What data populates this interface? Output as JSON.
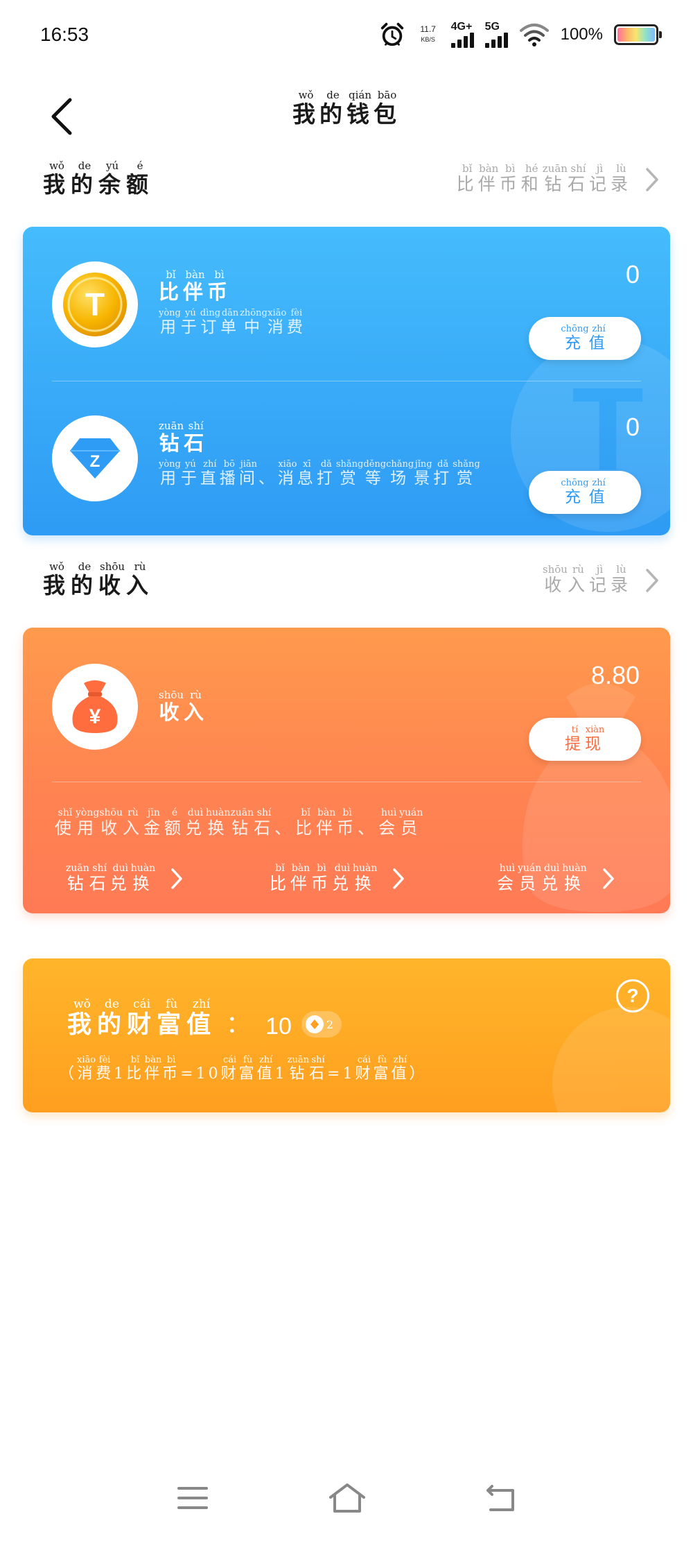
{
  "status_bar": {
    "time": "16:53",
    "net_speed_value": "11.7",
    "net_speed_unit": "KB/S",
    "signal_1_label": "4G+",
    "signal_2_label": "5G",
    "battery_percent": "100%"
  },
  "header": {
    "title_chars": [
      "我",
      "的",
      "钱",
      "包"
    ],
    "title_pinyin": [
      "wǒ",
      "de",
      "qián",
      "bāo"
    ]
  },
  "balance_section": {
    "title_chars": [
      "我",
      "的",
      "余",
      "额"
    ],
    "title_pinyin": [
      "wǒ",
      "de",
      "yú",
      "é"
    ],
    "link_chars": [
      "比",
      "伴",
      "币",
      "和",
      "钻",
      "石",
      "记",
      "录"
    ],
    "link_pinyin": [
      "bǐ",
      "bàn",
      "bì",
      "hé",
      "zuān",
      "shí",
      "jì",
      "lù"
    ]
  },
  "bibi_row": {
    "title_chars": [
      "比",
      "伴",
      "币"
    ],
    "title_pinyin": [
      "bǐ",
      "bàn",
      "bì"
    ],
    "desc_chars": [
      "用",
      "于",
      "订",
      "单",
      "中",
      "消",
      "费"
    ],
    "desc_pinyin": [
      "yòng",
      "yú",
      "dìng",
      "dān",
      "zhōng",
      "xiāo",
      "fèi"
    ],
    "value": "0",
    "button_chars": [
      "充",
      "值"
    ],
    "button_pinyin": [
      "chōng",
      "zhí"
    ],
    "icon_letter": "T"
  },
  "diamond_row": {
    "title_chars": [
      "钻",
      "石"
    ],
    "title_pinyin": [
      "zuān",
      "shí"
    ],
    "desc_chars": [
      "用",
      "于",
      "直",
      "播",
      "间",
      "、",
      "消",
      "息",
      "打",
      "赏",
      "等",
      "场",
      "景",
      "打",
      "赏"
    ],
    "desc_pinyin": [
      "yòng",
      "yú",
      "zhí",
      "bō",
      "jiān",
      "",
      "xiāo",
      "xī",
      "dǎ",
      "shǎng",
      "děng",
      "chǎng",
      "jǐng",
      "dǎ",
      "shǎng"
    ],
    "value": "0",
    "button_chars": [
      "充",
      "值"
    ],
    "button_pinyin": [
      "chōng",
      "zhí"
    ],
    "icon_letter": "Z"
  },
  "income_section": {
    "title_chars": [
      "我",
      "的",
      "收",
      "入"
    ],
    "title_pinyin": [
      "wǒ",
      "de",
      "shōu",
      "rù"
    ],
    "link_chars": [
      "收",
      "入",
      "记",
      "录"
    ],
    "link_pinyin": [
      "shōu",
      "rù",
      "jì",
      "lù"
    ]
  },
  "income_row": {
    "title_chars": [
      "收",
      "入"
    ],
    "title_pinyin": [
      "shōu",
      "rù"
    ],
    "value": "8.80",
    "button_chars": [
      "提",
      "现"
    ],
    "button_pinyin": [
      "tí",
      "xiàn"
    ],
    "icon_symbol": "¥",
    "exchange_desc_chars": [
      "使",
      "用",
      "收",
      "入",
      "金",
      "额",
      "兑",
      "换",
      "钻",
      "石",
      "、",
      "比",
      "伴",
      "币",
      "、",
      "会",
      "员"
    ],
    "exchange_desc_pinyin": [
      "shǐ",
      "yòng",
      "shōu",
      "rù",
      "jīn",
      "é",
      "duì",
      "huàn",
      "zuān",
      "shí",
      "",
      "bǐ",
      "bàn",
      "bì",
      "",
      "huì",
      "yuán"
    ],
    "exchange_links": [
      {
        "chars": [
          "钻",
          "石",
          "兑",
          "换"
        ],
        "pinyin": [
          "zuān",
          "shí",
          "duì",
          "huàn"
        ]
      },
      {
        "chars": [
          "比",
          "伴",
          "币",
          "兑",
          "换"
        ],
        "pinyin": [
          "bǐ",
          "bàn",
          "bì",
          "duì",
          "huàn"
        ]
      },
      {
        "chars": [
          "会",
          "员",
          "兑",
          "换"
        ],
        "pinyin": [
          "huì",
          "yuán",
          "duì",
          "huàn"
        ]
      }
    ]
  },
  "wealth_card": {
    "title_chars": [
      "我",
      "的",
      "财",
      "富",
      "值"
    ],
    "title_pinyin": [
      "wǒ",
      "de",
      "cái",
      "fù",
      "zhí"
    ],
    "colon": "：",
    "value": "10",
    "level_badge": "2",
    "desc_segments": [
      {
        "text": "（",
        "pinyin": ""
      },
      {
        "text": "消",
        "pinyin": "xiāo"
      },
      {
        "text": "费",
        "pinyin": "fèi"
      },
      {
        "text": "1",
        "pinyin": ""
      },
      {
        "text": "比",
        "pinyin": "bǐ"
      },
      {
        "text": "伴",
        "pinyin": "bàn"
      },
      {
        "text": "币",
        "pinyin": "bì"
      },
      {
        "text": "=10",
        "pinyin": ""
      },
      {
        "text": "财",
        "pinyin": "cái"
      },
      {
        "text": "富",
        "pinyin": "fù"
      },
      {
        "text": "值",
        "pinyin": "zhí"
      },
      {
        "text": "1",
        "pinyin": ""
      },
      {
        "text": "钻",
        "pinyin": "zuān"
      },
      {
        "text": "石",
        "pinyin": "shí"
      },
      {
        "text": "=1",
        "pinyin": ""
      },
      {
        "text": "财",
        "pinyin": "cái"
      },
      {
        "text": "富",
        "pinyin": "fù"
      },
      {
        "text": "值",
        "pinyin": "zhí"
      },
      {
        "text": "）",
        "pinyin": ""
      }
    ],
    "help_symbol": "?"
  },
  "icons": {
    "alarm": "alarm-clock-icon",
    "wifi": "wifi-icon",
    "back": "chevron-left-icon",
    "coin": "t-coin-icon",
    "diamond": "diamond-icon",
    "money_bag": "money-bag-icon",
    "help": "question-circle-icon",
    "menu": "menu-icon",
    "home": "home-icon",
    "return": "return-icon"
  },
  "colors": {
    "blue_card": "#2e9bf4",
    "orange_card": "#ff7a55",
    "gold_card": "#ffa020",
    "coin_gold": "#f5b400"
  }
}
